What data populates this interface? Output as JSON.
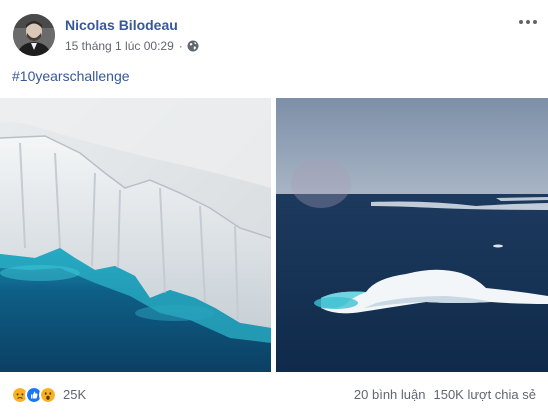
{
  "post": {
    "author": "Nicolas Bilodeau",
    "timestamp": "15 tháng 1 lúc 00:29",
    "separator": "·",
    "privacy_icon": "globe-icon",
    "hashtag": "#10yearschallenge"
  },
  "photos": [
    {
      "subject": "glacier-ice-cliff"
    },
    {
      "subject": "iceberg-in-open-sea"
    }
  ],
  "footer": {
    "reactions": [
      "sad",
      "like",
      "wow"
    ],
    "reaction_count": "25K",
    "comments": "20 bình luận",
    "shares": "150K lượt chia sẻ"
  },
  "colors": {
    "author_link": "#385898",
    "hashtag_link": "#365899",
    "meta_text": "#616770",
    "like_blue": "#1877f2",
    "reaction_yellow": "#f7b125"
  }
}
